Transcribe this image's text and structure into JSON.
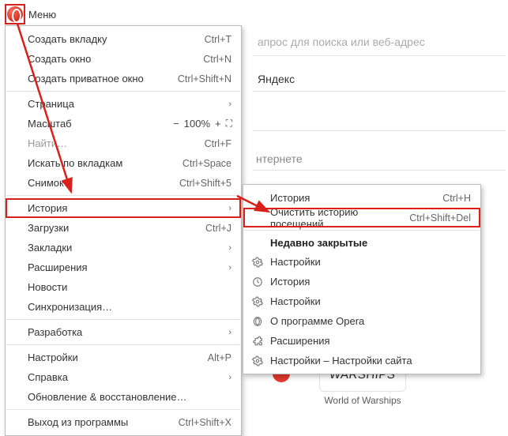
{
  "header": {
    "menu_label": "Меню",
    "address_placeholder": "апрос для поиска или веб-адрес",
    "yandex_label": "Яндекс",
    "internet_label": "нтернете"
  },
  "menu": {
    "new_tab": {
      "label": "Создать вкладку",
      "shortcut": "Ctrl+T"
    },
    "new_window": {
      "label": "Создать окно",
      "shortcut": "Ctrl+N"
    },
    "new_private": {
      "label": "Создать приватное окно",
      "shortcut": "Ctrl+Shift+N"
    },
    "page": {
      "label": "Страница"
    },
    "zoom": {
      "label": "Масштаб",
      "minus": "−",
      "value": "100%",
      "plus": "+",
      "fs": "⛶"
    },
    "find": {
      "label": "Найти…",
      "shortcut": "Ctrl+F"
    },
    "search_tabs": {
      "label": "Искать по вкладкам",
      "shortcut": "Ctrl+Space"
    },
    "snapshot": {
      "label": "Снимок",
      "shortcut": "Ctrl+Shift+5"
    },
    "history": {
      "label": "История"
    },
    "downloads": {
      "label": "Загрузки",
      "shortcut": "Ctrl+J"
    },
    "bookmarks": {
      "label": "Закладки"
    },
    "extensions": {
      "label": "Расширения"
    },
    "news": {
      "label": "Новости"
    },
    "sync": {
      "label": "Синхронизация…"
    },
    "dev": {
      "label": "Разработка"
    },
    "settings": {
      "label": "Настройки",
      "shortcut": "Alt+P"
    },
    "help": {
      "label": "Справка"
    },
    "update": {
      "label": "Обновление & восстановление…"
    },
    "exit": {
      "label": "Выход из программы",
      "shortcut": "Ctrl+Shift+X"
    }
  },
  "submenu": {
    "history": {
      "label": "История",
      "shortcut": "Ctrl+H"
    },
    "clear": {
      "label": "Очистить историю посещений",
      "shortcut": "Ctrl+Shift+Del"
    },
    "recent_header": "Недавно закрытые",
    "items": [
      {
        "icon": "gear-icon",
        "label": "Настройки"
      },
      {
        "icon": "clock-icon",
        "label": "История"
      },
      {
        "icon": "gear-icon",
        "label": "Настройки"
      },
      {
        "icon": "opera-icon",
        "label": "О программе Opera"
      },
      {
        "icon": "puzzle-icon",
        "label": "Расширения"
      },
      {
        "icon": "gear-icon",
        "label": "Настройки – Настройки сайта"
      }
    ]
  },
  "speed_dial": {
    "tile_logo": "WARSHIPS",
    "tile_caption": "World of Warships"
  }
}
